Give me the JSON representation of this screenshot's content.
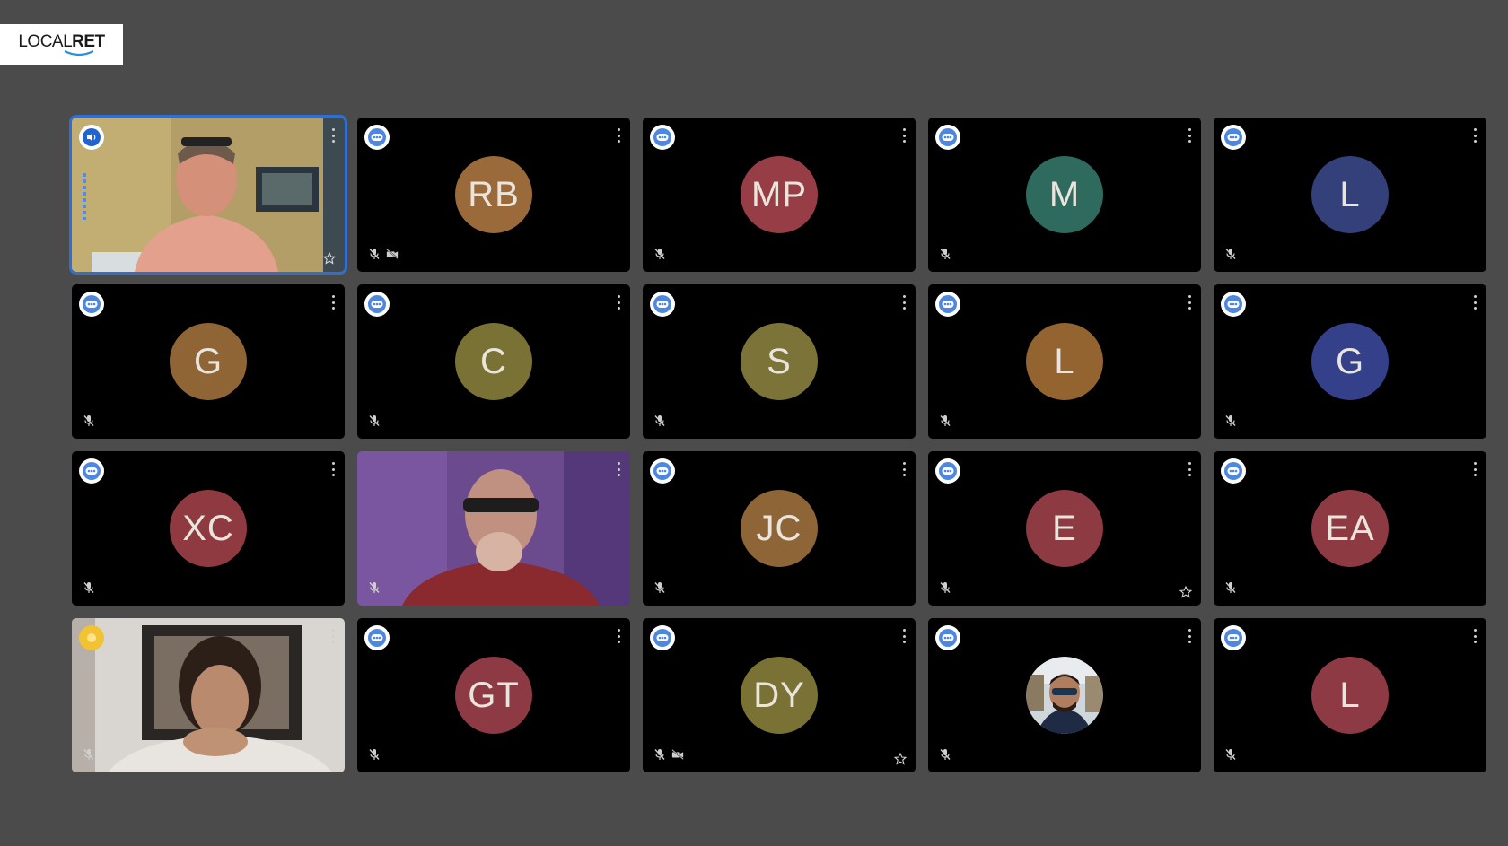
{
  "logo": {
    "prefix": "LOCAL",
    "suffix": "RET"
  },
  "colors": {
    "background": "#4b4b4c",
    "tile": "#000000",
    "active_border": "#2f6fd4"
  },
  "participants": [
    {
      "type": "video",
      "scene": "man-room",
      "badge": "speaking",
      "muted": false,
      "active": true,
      "pinned_icon": true
    },
    {
      "type": "avatar",
      "initials": "RB",
      "color": "#9b6a3a",
      "muted": true,
      "camera_off": true
    },
    {
      "type": "avatar",
      "initials": "MP",
      "color": "#973d45",
      "muted": true
    },
    {
      "type": "avatar",
      "initials": "M",
      "color": "#2f6a5f",
      "muted": true
    },
    {
      "type": "avatar",
      "initials": "L",
      "color": "#33407a",
      "muted": true
    },
    {
      "type": "avatar",
      "initials": "G",
      "color": "#8f6536",
      "muted": true
    },
    {
      "type": "avatar",
      "initials": "C",
      "color": "#7a7234",
      "muted": true
    },
    {
      "type": "avatar",
      "initials": "S",
      "color": "#7c7338",
      "muted": true
    },
    {
      "type": "avatar",
      "initials": "L",
      "color": "#93642f",
      "muted": true
    },
    {
      "type": "avatar",
      "initials": "G",
      "color": "#34408a",
      "muted": true
    },
    {
      "type": "avatar",
      "initials": "XC",
      "color": "#8e3a40",
      "muted": true
    },
    {
      "type": "video",
      "scene": "man-purple",
      "badge": null,
      "muted": true
    },
    {
      "type": "avatar",
      "initials": "JC",
      "color": "#8e6536",
      "muted": true
    },
    {
      "type": "avatar",
      "initials": "E",
      "color": "#8e3a42",
      "muted": true,
      "pinned_icon": true
    },
    {
      "type": "avatar",
      "initials": "EA",
      "color": "#8e3a42",
      "muted": true
    },
    {
      "type": "video",
      "scene": "man-curly",
      "badge": "hand",
      "muted": true
    },
    {
      "type": "avatar",
      "initials": "GT",
      "color": "#8e3a44",
      "muted": true
    },
    {
      "type": "avatar",
      "initials": "DY",
      "color": "#7a7234",
      "muted": true,
      "camera_off": true,
      "pinned_icon": true
    },
    {
      "type": "photo",
      "scene": "man-sunglasses",
      "muted": true
    },
    {
      "type": "avatar",
      "initials": "L",
      "color": "#8e3a44",
      "muted": true
    }
  ]
}
